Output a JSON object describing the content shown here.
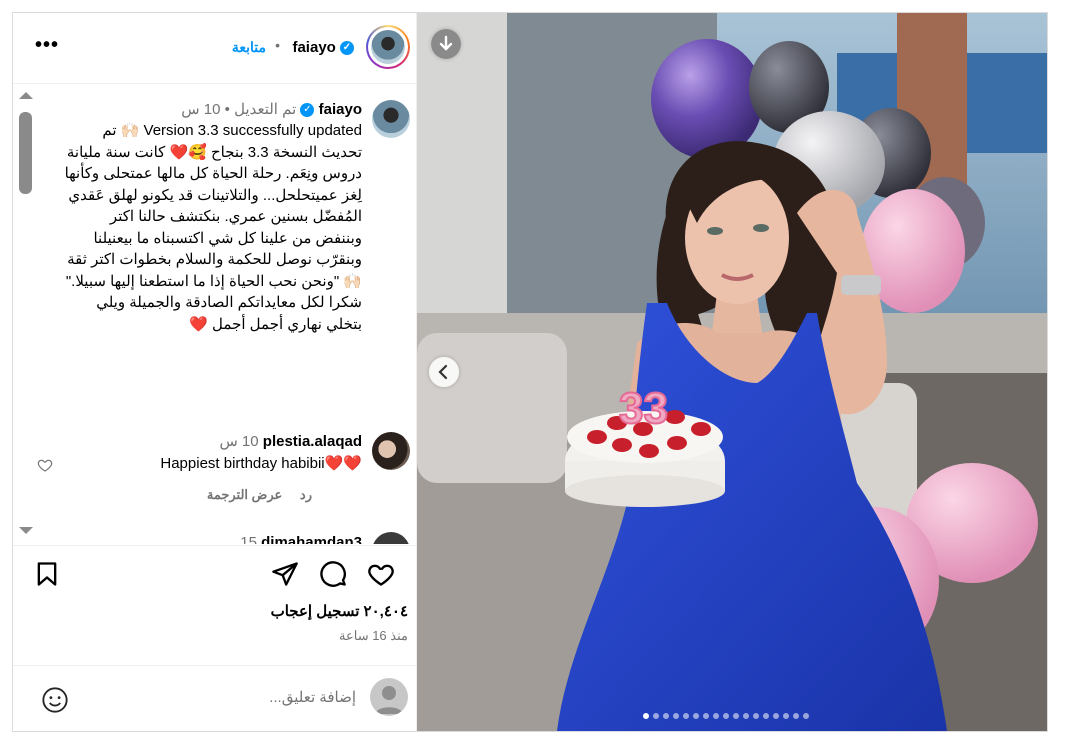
{
  "header": {
    "username": "faiayo",
    "follow_label": "متابعة",
    "separator": "•",
    "more_label": "•••"
  },
  "caption": {
    "username": "faiayo",
    "edited_label": "تم التعديل",
    "separator": "•",
    "time": "10 س",
    "text": "Version 3.3 successfully updated 🙌🏻 تم تحديث النسخة 3.3 بنجاح 🥰❤️ كانت سنة مليانة دروس ونِعَم. رحلة الحياة كل مالها عمتحلى وكأنها لِغز عميتحلحل... والتلاتينات قد يكونو لهلق عَقدي المُفضّل بسنين عمري. بنكتشف حالنا اكتر وبننفض من علينا كل شي اكتسبناه ما بيعنيلنا وبنقرّب نوصل للحكمة والسلام بخطوات اكتر ثقة 🙌🏻 \"ونحن نحب الحياة إذا ما استطعنا إليها سبيلا.\" شكرا لكل معايداتكم الصادقة والجميلة ويلي بتخلي نهاري أجمل أجمل ❤️"
  },
  "comments": [
    {
      "username": "plestia.alaqad",
      "time": "10 س",
      "text": "Happiest birthday habibii❤️❤️",
      "reply_label": "رد",
      "translate_label": "عرض الترجمة"
    },
    {
      "username": "dimahamdan3",
      "time": "15"
    }
  ],
  "actions": {
    "likes": "٢٠,٤٠٤ تسجيل إعجاب",
    "time_ago": "منذ 16 ساعة"
  },
  "add_comment": {
    "placeholder": "إضافة تعليق..."
  },
  "photo": {
    "cake_number": "33",
    "carousel_count": 17,
    "carousel_active": 0
  },
  "colors": {
    "accent": "#0095f6",
    "heart_red": "#ed4956",
    "dress_blue": "#1f3ec4"
  }
}
